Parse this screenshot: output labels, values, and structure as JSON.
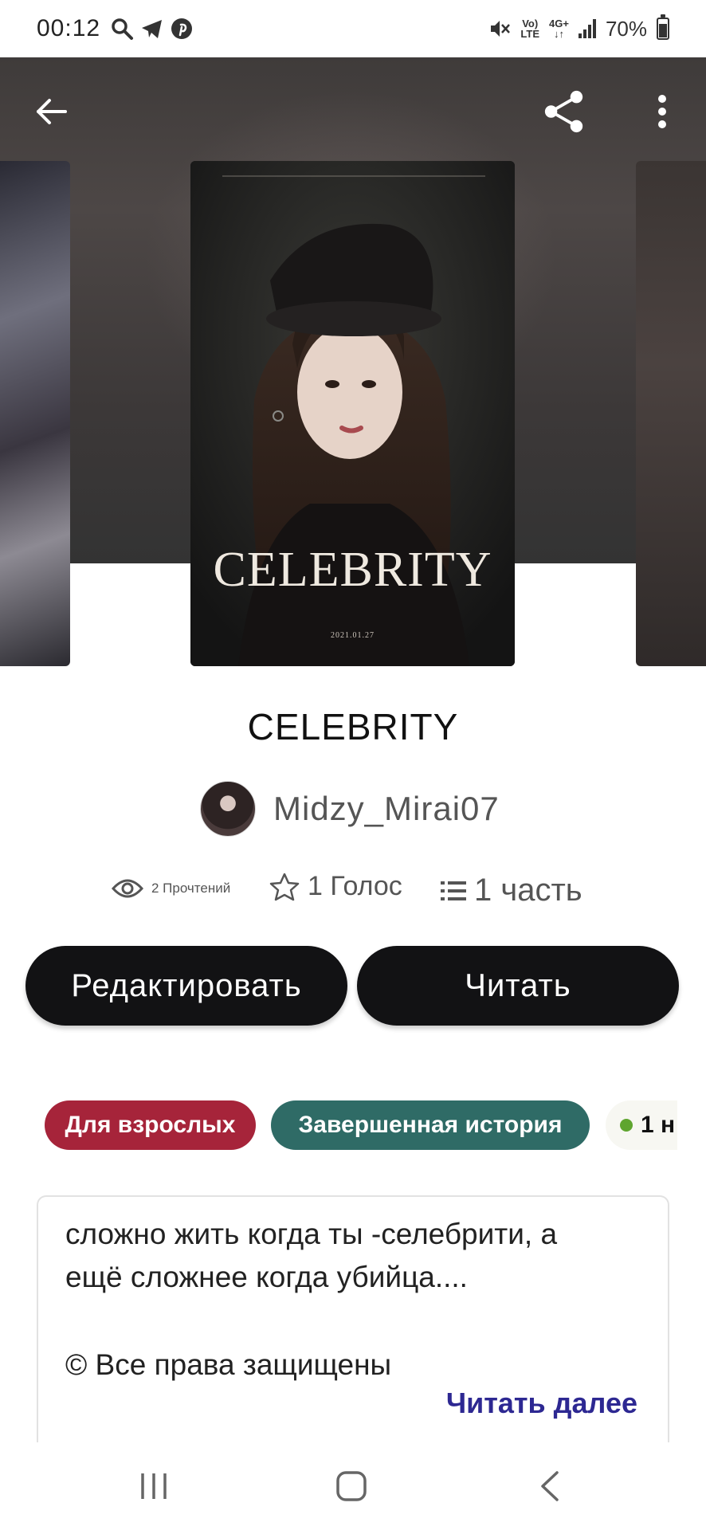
{
  "status_bar": {
    "time": "00:12",
    "network_top": "Vo)",
    "network_bottom": "LTE",
    "data_type": "4G+",
    "battery": "70%"
  },
  "cover": {
    "title_text": "CELEBRITY",
    "date_text": "2021.01.27"
  },
  "story": {
    "title": "CELEBRITY",
    "author": "Midzy_Mirai07",
    "stats": {
      "reads": "2 Прочтений",
      "votes": "1 Голос",
      "parts": "1 часть"
    }
  },
  "buttons": {
    "edit": "Редактировать",
    "read": "Читать"
  },
  "tags": {
    "mature": "Для взрослых",
    "complete": "Завершенная история",
    "parts": "1 н"
  },
  "description": {
    "line1": "сложно жить когда ты -селебрити, а",
    "line2": "ещё сложнее когда убийца....",
    "copyright": "© Все права защищены",
    "read_more": "Читать далее"
  },
  "colors": {
    "mature_tag": "#a6243a",
    "complete_tag": "#2f6b66",
    "read_more": "#2d2892",
    "button_bg": "#121214"
  }
}
